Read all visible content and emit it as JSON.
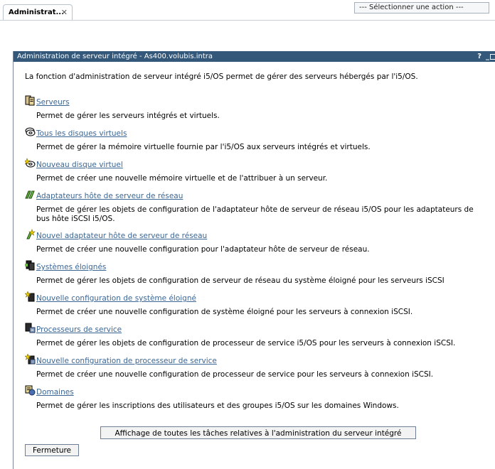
{
  "tab": {
    "label": "Administrat...",
    "close": "✕"
  },
  "action_select": {
    "value": "--- Sélectionner une action ---"
  },
  "portlet": {
    "title": "Administration de serveur intégré - As400.volubis.intra",
    "help": "?",
    "minimize": "_"
  },
  "intro": "La fonction d'administration de serveur intégré i5/OS permet de gérer des serveurs hébergés par l'i5/OS.",
  "tasks": [
    {
      "icon": "server-icon",
      "link": "Serveurs",
      "desc": "Permet de gérer les serveurs intégrés et virtuels."
    },
    {
      "icon": "virtual-disks-icon",
      "link": "Tous les disques virtuels",
      "desc": "Permet de gérer la mémoire virtuelle fournie par l'i5/OS aux serveurs intégrés et virtuels."
    },
    {
      "icon": "new-virtual-disk-icon",
      "link": "Nouveau disque virtuel",
      "desc": "Permet de créer une nouvelle mémoire virtuelle et de l'attribuer à un serveur."
    },
    {
      "icon": "network-adapter-icon",
      "link": "Adaptateurs hôte de serveur de réseau",
      "desc": "Permet de gérer les objets de configuration de l'adaptateur hôte de serveur de réseau i5/OS pour les adaptateurs de",
      "desc2": "bus hôte iSCSI i5/OS."
    },
    {
      "icon": "new-network-adapter-icon",
      "link": "Nouvel adaptateur hôte de serveur de réseau",
      "desc": "Permet de créer une nouvelle configuration pour l'adaptateur hôte de serveur de réseau."
    },
    {
      "icon": "remote-systems-icon",
      "link": "Systèmes éloignés",
      "desc": "Permet de gérer les objets de configuration de serveur de réseau du système éloigné pour les serveurs iSCSI"
    },
    {
      "icon": "new-remote-system-icon",
      "link": "Nouvelle configuration de système éloigné",
      "desc": "Permet de créer une nouvelle configuration de système éloigné pour les serveurs à connexion iSCSI."
    },
    {
      "icon": "service-processor-icon",
      "link": "Processeurs de service",
      "desc": "Permet de gérer les objets de configuration de processeur de service i5/OS pour les serveurs à connexion iSCSI."
    },
    {
      "icon": "new-service-processor-icon",
      "link": "Nouvelle configuration de processeur de service",
      "desc": "Permet de créer une nouvelle configuration de processeur de service pour les serveurs à connexion iSCSI."
    },
    {
      "icon": "domains-icon",
      "link": "Domaines",
      "desc": "Permet de gérer les inscriptions des utilisateurs et des groupes i5/OS sur les domaines Windows."
    }
  ],
  "buttons": {
    "show_all": "Affichage de toutes les tâches relatives à l'administration du serveur intégré",
    "close": "Fermeture"
  }
}
